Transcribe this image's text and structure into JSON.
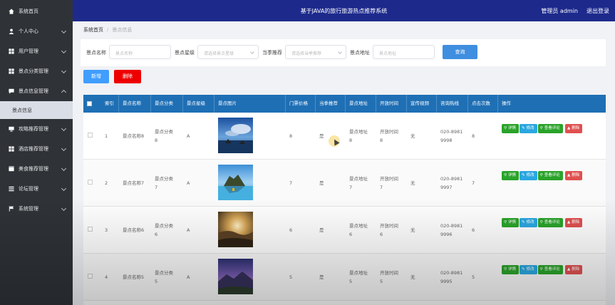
{
  "header": {
    "title": "基于JAVA的旅行旅游热点推荐系统",
    "user": "管理员 admin",
    "logout": "退出登录"
  },
  "sidebar": {
    "items": [
      {
        "label": "系统首页",
        "icon": "home-icon"
      },
      {
        "label": "个人中心",
        "icon": "user-icon"
      },
      {
        "label": "用户管理",
        "icon": "grid-icon"
      },
      {
        "label": "景点分类管理",
        "icon": "grid-icon"
      },
      {
        "label": "景点信息管理",
        "icon": "chat-icon"
      },
      {
        "label": "攻略推荐管理",
        "icon": "monitor-icon"
      },
      {
        "label": "酒店推荐管理",
        "icon": "grid-icon"
      },
      {
        "label": "美食推荐管理",
        "icon": "box-icon"
      },
      {
        "label": "论坛管理",
        "icon": "list-icon"
      },
      {
        "label": "系统管理",
        "icon": "flag-icon"
      }
    ],
    "active_sub": "景点信息"
  },
  "breadcrumb": {
    "home": "系统首页",
    "sep": "/",
    "current": "景点信息"
  },
  "search": {
    "name_label": "景点名称",
    "name_placeholder": "景点名称",
    "level_label": "景点星级",
    "level_placeholder": "请选择景点星级",
    "season_label": "当季推荐",
    "season_placeholder": "请选择当季推荐",
    "address_label": "景点地址",
    "address_placeholder": "景点地址",
    "query": "查询"
  },
  "actions": {
    "add": "新增",
    "delete": "删除"
  },
  "table": {
    "headers": [
      "索引",
      "景点名称",
      "景点分类",
      "景点星级",
      "景点图片",
      "门票价格",
      "当季推荐",
      "景点地址",
      "开放时间",
      "宣传视频",
      "咨询热线",
      "点击次数",
      "操作"
    ],
    "ops": {
      "detail": "详情",
      "edit": "修改",
      "comment": "查看评论",
      "del": "删除"
    },
    "rows": [
      {
        "index": "1",
        "name": "景点名称8",
        "cat1": "景点分类",
        "cat2": "8",
        "level": "A",
        "price": "8",
        "season": "是",
        "addr1": "景点地址",
        "addr2": "8",
        "open1": "开放时间",
        "open2": "8",
        "video": "无",
        "tel1": "020-8981",
        "tel2": "9998",
        "clicks": "8"
      },
      {
        "index": "2",
        "name": "景点名称7",
        "cat1": "景点分类",
        "cat2": "7",
        "level": "A",
        "price": "7",
        "season": "是",
        "addr1": "景点地址",
        "addr2": "7",
        "open1": "开放时间",
        "open2": "7",
        "video": "无",
        "tel1": "020-8981",
        "tel2": "9997",
        "clicks": "7"
      },
      {
        "index": "3",
        "name": "景点名称6",
        "cat1": "景点分类",
        "cat2": "6",
        "level": "A",
        "price": "6",
        "season": "是",
        "addr1": "景点地址",
        "addr2": "6",
        "open1": "开放时间",
        "open2": "6",
        "video": "无",
        "tel1": "020-8981",
        "tel2": "9996",
        "clicks": "6"
      },
      {
        "index": "4",
        "name": "景点名称5",
        "cat1": "景点分类",
        "cat2": "5",
        "level": "A",
        "price": "5",
        "season": "是",
        "addr1": "景点地址",
        "addr2": "5",
        "open1": "开放时间",
        "open2": "5",
        "video": "无",
        "tel1": "020-8981",
        "tel2": "9995",
        "clicks": "5"
      }
    ]
  },
  "colors": {
    "header_bg": "#1d2a8c",
    "sidebar_bg": "#2f3338",
    "table_head_bg": "#1f6fb5",
    "primary": "#409eff",
    "danger": "#ee0000",
    "success": "#2aa32a"
  }
}
